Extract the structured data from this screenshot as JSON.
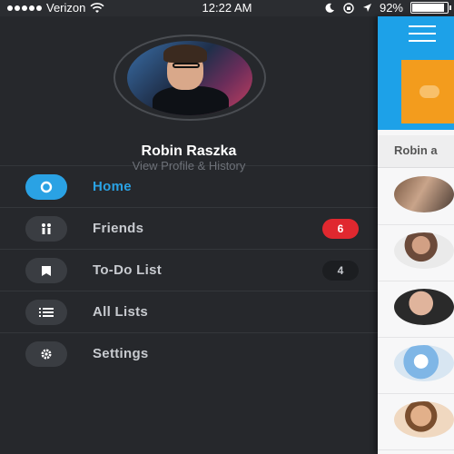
{
  "status_bar": {
    "carrier": "Verizon",
    "time": "12:22 AM",
    "battery": "92%",
    "battery_level": 0.92,
    "icons": [
      "signal-dots-icon",
      "wifi-icon",
      "moon-icon",
      "lock-rotation-icon",
      "location-arrow-icon",
      "battery-icon"
    ]
  },
  "profile": {
    "name": "Robin Raszka",
    "subtitle": "View Profile & History"
  },
  "menu": {
    "items": [
      {
        "label": "Home",
        "icon": "location-pin-icon",
        "active": true,
        "badge": ""
      },
      {
        "label": "Friends",
        "icon": "friends-icon",
        "active": false,
        "badge": "6"
      },
      {
        "label": "To-Do List",
        "icon": "bookmark-icon",
        "active": false,
        "badge": "4"
      },
      {
        "label": "All Lists",
        "icon": "list-icon",
        "active": false,
        "badge": ""
      },
      {
        "label": "Settings",
        "icon": "gear-icon",
        "active": false,
        "badge": ""
      }
    ]
  },
  "content": {
    "header_text": "Robin a",
    "menu_icon": "hamburger-icon"
  },
  "colors": {
    "accent": "#2aa2e4",
    "drawer_bg": "#26282c",
    "badge_red": "#e0282f",
    "content_topbar": "#1da1e8",
    "card_orange": "#f39c1d"
  }
}
